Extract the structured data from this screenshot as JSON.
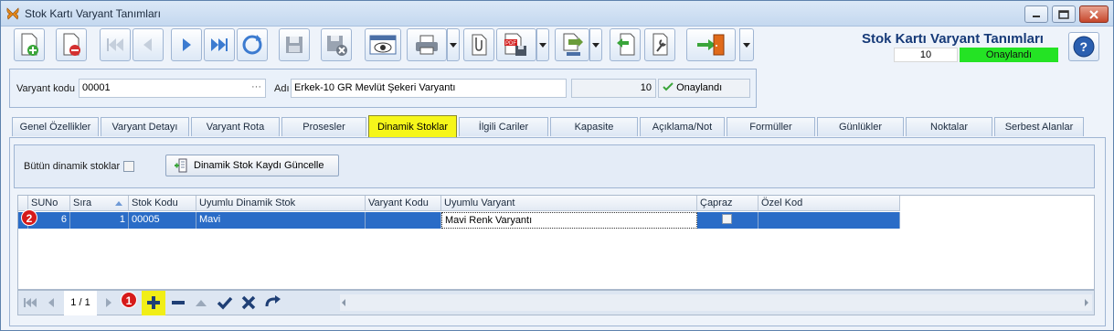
{
  "window": {
    "title": "Stok Kartı Varyant Tanımları",
    "minimize_icon": "minimize-icon",
    "maximize_icon": "maximize-icon",
    "close_icon": "close-icon"
  },
  "toolbar": {
    "buttons": [
      {
        "name": "new-record-button",
        "icon": "new-document-icon"
      },
      {
        "name": "delete-record-button",
        "icon": "delete-document-icon"
      },
      {
        "name": "first-record-button",
        "icon": "first-icon"
      },
      {
        "name": "prev-record-button",
        "icon": "prev-icon"
      },
      {
        "name": "next-record-button",
        "icon": "next-icon"
      },
      {
        "name": "last-record-button",
        "icon": "last-icon"
      },
      {
        "name": "refresh-button",
        "icon": "refresh-icon"
      },
      {
        "name": "save-button",
        "icon": "save-icon"
      },
      {
        "name": "cancel-save-button",
        "icon": "save-cancel-icon"
      },
      {
        "name": "preview-button",
        "icon": "eye-icon"
      },
      {
        "name": "print-button",
        "icon": "printer-icon"
      },
      {
        "name": "attach-button",
        "icon": "paperclip-icon"
      },
      {
        "name": "pdf-button",
        "icon": "pdf-icon"
      },
      {
        "name": "export-button",
        "icon": "export-icon"
      },
      {
        "name": "import-button",
        "icon": "import-icon"
      },
      {
        "name": "tools-button",
        "icon": "wrench-icon"
      },
      {
        "name": "exit-button",
        "icon": "exit-door-icon"
      }
    ]
  },
  "header": {
    "title": "Stok Kartı Varyant Tanımları",
    "count": "10",
    "status": "Onaylandı",
    "status_color": "#24e324"
  },
  "form": {
    "code_label": "Varyant kodu",
    "code_value": "00001",
    "name_label": "Adı",
    "name_value": "Erkek-10 GR Mevlüt Şekeri Varyantı",
    "count_value": "10",
    "status_value": "Onaylandı"
  },
  "tabs": [
    {
      "label": "Genel Özellikler"
    },
    {
      "label": "Varyant Detayı"
    },
    {
      "label": "Varyant Rota"
    },
    {
      "label": "Prosesler"
    },
    {
      "label": "Dinamik Stoklar",
      "active": true
    },
    {
      "label": "İlgili Cariler"
    },
    {
      "label": "Kapasite"
    },
    {
      "label": "Açıklama/Not"
    },
    {
      "label": "Formüller"
    },
    {
      "label": "Günlükler"
    },
    {
      "label": "Noktalar"
    },
    {
      "label": "Serbest Alanlar"
    }
  ],
  "filter": {
    "checkbox_label": "Bütün dinamik stoklar",
    "button_label": "Dinamik Stok Kaydı Güncelle"
  },
  "grid": {
    "columns": [
      "SUNo",
      "Sıra",
      "Stok Kodu",
      "Uyumlu Dinamik Stok",
      "Varyant Kodu",
      "Uyumlu Varyant",
      "Çapraz",
      "Özel Kod"
    ],
    "rows": [
      {
        "suno": "6",
        "sira": "1",
        "stok_kodu": "00005",
        "uyumlu_dinamik_stok": "Mavi",
        "varyant_kodu": "",
        "uyumlu_varyant": "Mavi Renk Varyantı",
        "capraz": false,
        "ozel_kod": ""
      }
    ]
  },
  "navigator": {
    "page": "1 / 1"
  },
  "markers": {
    "one": "1",
    "two": "2"
  }
}
